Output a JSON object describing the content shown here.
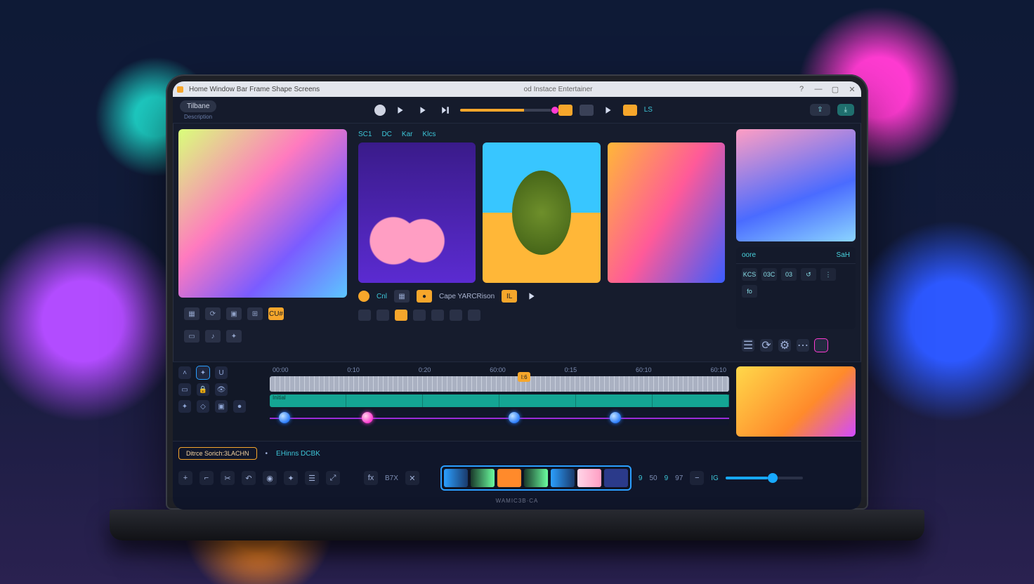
{
  "titlebar": {
    "menu": "Home  Window  Bar  Frame  Shape  Screens",
    "center": "od Instace Entertainer",
    "win": {
      "help": "?",
      "min": "—",
      "max": "▢",
      "close": "✕"
    }
  },
  "ribbon": {
    "tab": "Tilbane",
    "sub": "Description",
    "filters": [
      "SC1",
      "DC",
      "Kar",
      "Klcs"
    ],
    "btn_share": "⇪",
    "btn_export": "⤓"
  },
  "sidebar": {
    "icons": [
      "▦",
      "⟳",
      "▣",
      "⊞",
      "CU#"
    ]
  },
  "gallery": {
    "tool_caption": "Cape YARCRison",
    "tool_cnt": "Cnl"
  },
  "right": {
    "tab_a": "oore",
    "tab_b": "SaH",
    "buttons": [
      "KCS",
      "03C",
      "03",
      "↺",
      "⋮",
      "fo"
    ]
  },
  "timeline": {
    "ticks": [
      "00:00",
      "0:10",
      "0:20",
      "60:00",
      "0:15",
      "60:10",
      "60:10"
    ],
    "marker": "I:6",
    "clip_labels": [
      "Initial",
      "",
      "",
      "",
      "",
      ""
    ],
    "source_a": "Ditrce  Sorich:3LACHN",
    "source_b": "EHinns  DCBK"
  },
  "footer": {
    "bk": "B7X",
    "fx": "fx",
    "meta": [
      "9",
      "50",
      "9",
      "97",
      "IG"
    ]
  },
  "hinge": "WAMIC3B·CA"
}
